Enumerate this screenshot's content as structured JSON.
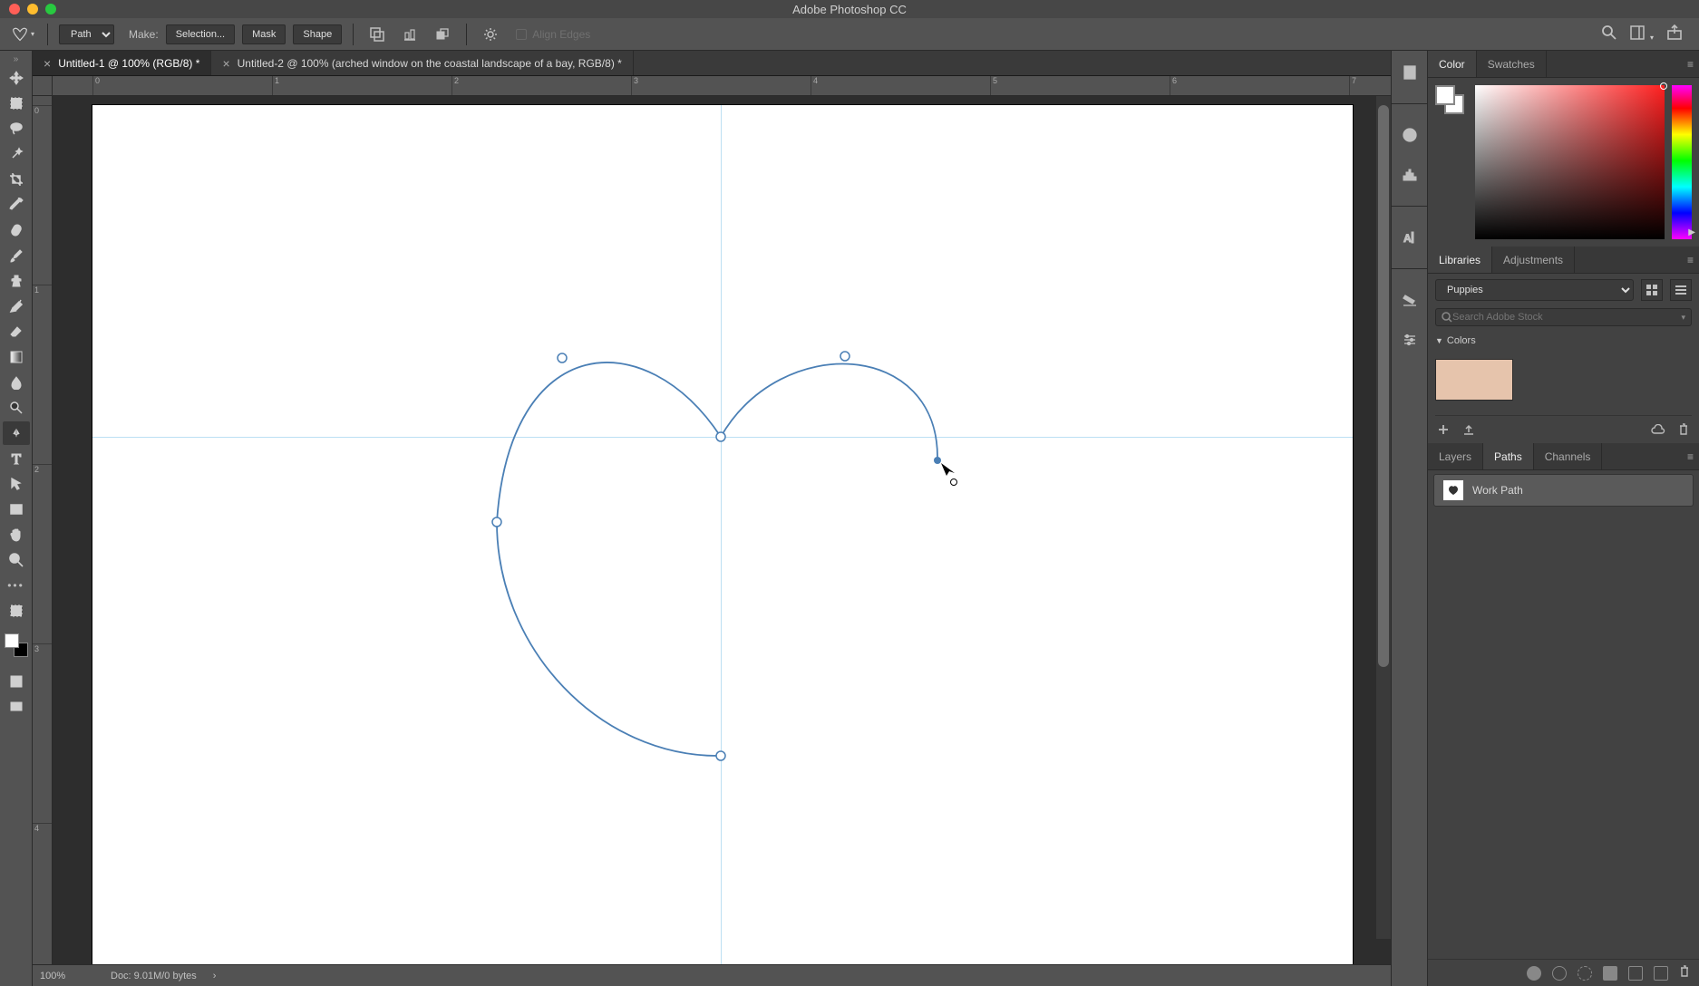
{
  "app": {
    "title": "Adobe Photoshop CC"
  },
  "options_bar": {
    "mode_select": "Path",
    "make_label": "Make:",
    "selection_btn": "Selection...",
    "mask_btn": "Mask",
    "shape_btn": "Shape",
    "align_edges": "Align Edges"
  },
  "doc_tabs": {
    "tab1": "Untitled-1 @ 100% (RGB/8) *",
    "tab2": "Untitled-2 @ 100% (arched window on the coastal landscape of a bay, RGB/8) *"
  },
  "ruler_h": [
    "0",
    "1",
    "2",
    "3",
    "4",
    "5",
    "6",
    "7"
  ],
  "ruler_v": [
    "0",
    "1",
    "2",
    "3",
    "4"
  ],
  "status": {
    "zoom": "100%",
    "doc_info": "Doc: 9.01M/0 bytes",
    "arrow": "›"
  },
  "panels": {
    "color_tab": "Color",
    "swatches_tab": "Swatches",
    "libraries_tab": "Libraries",
    "adjustments_tab": "Adjustments",
    "layers_tab": "Layers",
    "paths_tab": "Paths",
    "channels_tab": "Channels"
  },
  "libraries": {
    "selected": "Puppies",
    "search_placeholder": "Search Adobe Stock",
    "colors_header": "Colors",
    "color_chip_hex": "#e6c4ac"
  },
  "paths": {
    "item_label": "Work Path"
  }
}
